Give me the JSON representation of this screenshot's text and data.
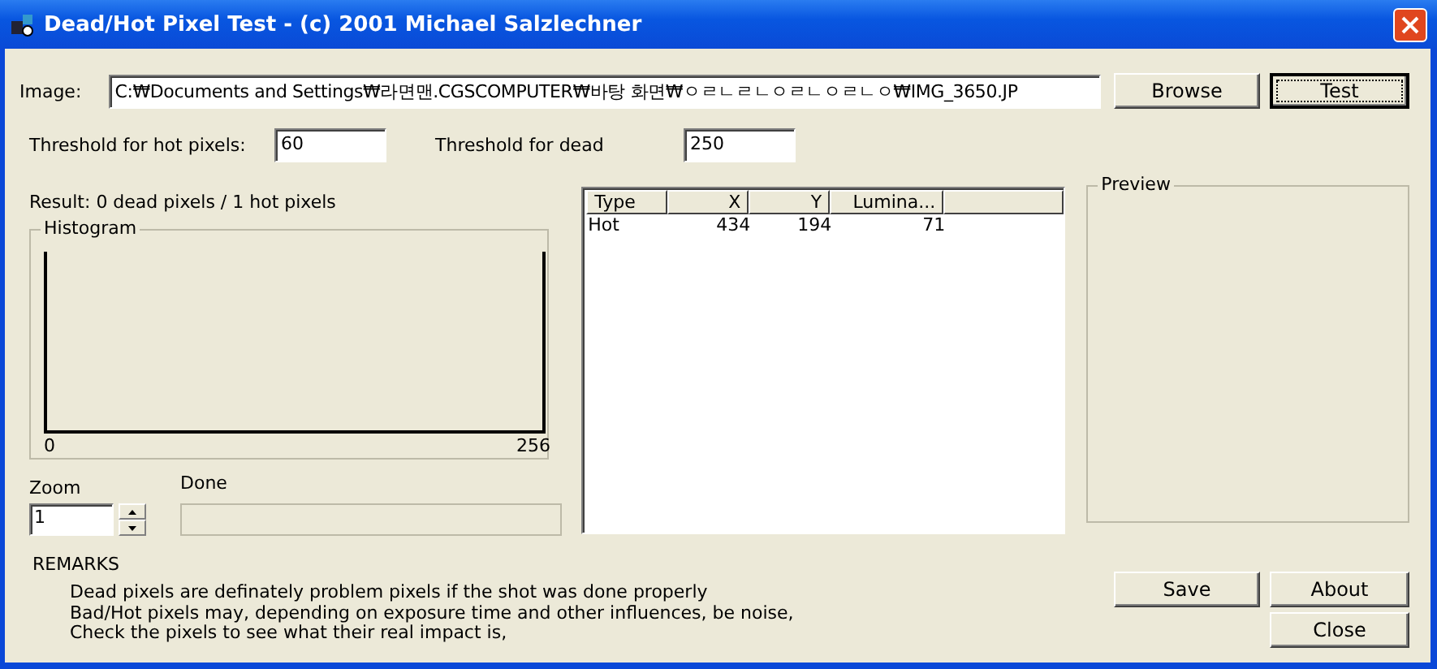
{
  "window": {
    "title": "Dead/Hot Pixel Test - (c) 2001 Michael Salzlechner"
  },
  "image": {
    "label": "Image:",
    "value": "C:₩Documents and Settings₩라면맨.CGSCOMPUTER₩바탕 화면₩ㅇㄹㄴㄹㄴㅇㄹㄴㅇㄹㄴㅇ₩IMG_3650.JP"
  },
  "top_buttons": [
    {
      "label": "Browse",
      "focused": false
    },
    {
      "label": "Test",
      "focused": true
    }
  ],
  "thresholds": [
    {
      "label": "Threshold for hot pixels:",
      "value": "60"
    },
    {
      "label": "Threshold for dead",
      "value": "250"
    }
  ],
  "result": "Result:  0 dead pixels / 1 hot pixels",
  "histogram": {
    "title": "Histogram",
    "min_label": "0",
    "max_label": "256"
  },
  "zoom": {
    "label": "Zoom",
    "value": "1"
  },
  "progress": {
    "label": "Done",
    "level": 0
  },
  "table": {
    "columns": [
      "Type",
      "X",
      "Y",
      "Lumina..."
    ],
    "rows": [
      [
        "Hot",
        "434",
        "194",
        "71"
      ]
    ]
  },
  "preview": {
    "title": "Preview"
  },
  "remarks": {
    "title": "REMARKS",
    "lines": [
      "Dead pixels are definately problem pixels if the shot was done properly",
      "Bad/Hot pixels may, depending on exposure time and other influences, be noise,",
      "Check the pixels to see what their real impact is,"
    ]
  },
  "bottom_buttons": [
    {
      "label": "Save",
      "focused": false
    },
    {
      "label": "About",
      "focused": false
    },
    {
      "label": "Close",
      "focused": false
    }
  ]
}
